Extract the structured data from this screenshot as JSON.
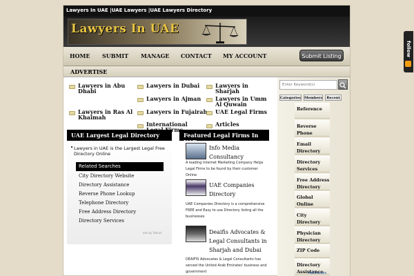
{
  "topbar": {
    "title": "Lawyers In UAE |UAE Lawyers |UAE Lawyers Directory"
  },
  "header": {
    "logo_text": "Lawyers In UAE"
  },
  "nav": {
    "items": [
      "HOME",
      "SUBMIT",
      "MANAGE",
      "CONTACT",
      "MY ACCOUNT"
    ],
    "submit_listing": "Submit Listing",
    "second_row": "ADVERTISE"
  },
  "categories": [
    "Lawyers in Abu Dhabi",
    "Lawyers in Dubai",
    "Lawyers in Sharjah",
    "Lawyers in Ajman",
    "Lawyers in Umm Al Quwain",
    "Lawyers in Ras Al Khaimah",
    "Lawyers in Fujairah",
    "UAE Legal Firms",
    "International Legal Firms",
    "Articles"
  ],
  "left_panel": {
    "title": "UAE Largest Legal Directory",
    "bullet": "Lawyers in UAE is the Largest Legal Free Directory Online",
    "related_title": "Related Searches",
    "related": [
      "City Directory Website",
      "Directory Assistance",
      "Reverse Phone Lookup",
      "Telephone Directory",
      "Free Address Directory",
      "Directory Services"
    ],
    "ads_by": "ads by Yahoo!"
  },
  "featured": {
    "title": "Featured Legal Firms In UAE",
    "items": [
      {
        "name": "Info Media Consultancy",
        "desc": "A leading Internet Marketing Company Helps Legal Firms to be found by their customer Online"
      },
      {
        "name": "UAE Companies Directory",
        "desc": "UAE Companies Directory is a comprehensive FREE and Easy to use Directory listing all the businesses"
      },
      {
        "name": "Deaifis Advocates & Legal Consultants in Sharjah and Dubai UAE",
        "desc": "DEAIFIS Advocates & Legal Consultants has served the United Arab Emirates' business and government"
      }
    ]
  },
  "sidebar": {
    "search_placeholder": "Enter Keyword(s)",
    "tabs": [
      "Categories",
      "Members",
      "Recent"
    ],
    "items": [
      "Reference",
      "Reverse Phone Lookup",
      "Email Directory",
      "Directory Services",
      "Free Address Directory",
      "Global Online Business",
      "City Directory",
      "Physician Directory",
      "ZIP Code",
      "Directory Assistance"
    ]
  },
  "follow": {
    "label": "follow"
  },
  "adchoices": "AdChoices",
  "colors": {
    "background": "#e4dcc8",
    "nav_dark": "#000000",
    "logo_gold": "#e8c542"
  }
}
